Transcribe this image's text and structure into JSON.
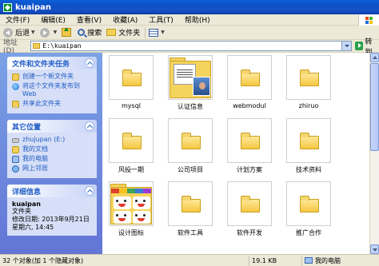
{
  "window": {
    "title": "kuaipan"
  },
  "menu": [
    "文件(F)",
    "编辑(E)",
    "查看(V)",
    "收藏(A)",
    "工具(T)",
    "帮助(H)"
  ],
  "toolbar": {
    "back": "后退",
    "search": "搜索",
    "folders": "文件夹"
  },
  "address": {
    "label": "地址(D)",
    "path": "E:\\kuaipan",
    "go": "转到"
  },
  "tasks_panel": {
    "title": "文件和文件夹任务",
    "items": [
      {
        "label": "创建一个新文件夹",
        "icon": "new-folder-icon"
      },
      {
        "label": "将这个文件夹发布到 Web",
        "icon": "publish-web-icon"
      },
      {
        "label": "共享此文件夹",
        "icon": "share-folder-icon"
      }
    ]
  },
  "places_panel": {
    "title": "其它位置",
    "items": [
      {
        "label": "zhujupan (E:)",
        "icon": "drive-icon"
      },
      {
        "label": "我的文档",
        "icon": "my-documents-icon"
      },
      {
        "label": "我的电脑",
        "icon": "my-computer-icon"
      },
      {
        "label": "网上邻居",
        "icon": "network-places-icon"
      }
    ]
  },
  "details_panel": {
    "title": "详细信息",
    "name": "kuaipan",
    "type": "文件夹",
    "modified": "修改日期: 2013年9月21日星期六, 14:45"
  },
  "files": [
    {
      "name": "mysql",
      "thumb": "folder"
    },
    {
      "name": "认证信息",
      "thumb": "preview-docs"
    },
    {
      "name": "webmodul",
      "thumb": "folder"
    },
    {
      "name": "zhiruo",
      "thumb": "folder"
    },
    {
      "name": "风投一期",
      "thumb": "folder"
    },
    {
      "name": "公司项目",
      "thumb": "folder"
    },
    {
      "name": "计划方案",
      "thumb": "folder"
    },
    {
      "name": "技术资料",
      "thumb": "folder"
    },
    {
      "name": "设计图标",
      "thumb": "preview-icons"
    },
    {
      "name": "软件工具",
      "thumb": "folder"
    },
    {
      "name": "软件开发",
      "thumb": "folder"
    },
    {
      "name": "推广合作",
      "thumb": "folder"
    }
  ],
  "status": {
    "objects": "32 个对象(加 1 个隐藏对象)",
    "size": "19.1 KB",
    "location": "我的电脑"
  }
}
